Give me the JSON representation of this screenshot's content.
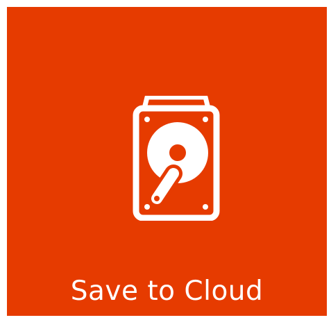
{
  "tile": {
    "label": "Save to Cloud",
    "icon": "hard-drive-icon",
    "background_color": "#e63b00",
    "foreground_color": "#ffffff"
  }
}
